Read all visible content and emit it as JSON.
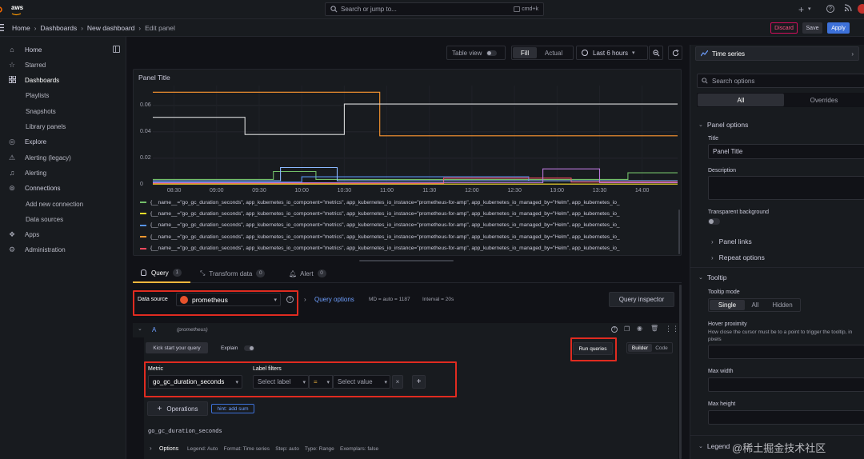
{
  "topbar": {
    "aws_label": "aws",
    "search_placeholder": "Search or jump to...",
    "search_shortcut": "cmd+k"
  },
  "breadcrumb": {
    "items": [
      "Home",
      "Dashboards",
      "New dashboard",
      "Edit panel"
    ],
    "discard_label": "Discard",
    "save_label": "Save",
    "apply_label": "Apply"
  },
  "sidebar": {
    "items": [
      {
        "label": "Home",
        "icon": "home-icon"
      },
      {
        "label": "Starred",
        "icon": "star-icon"
      },
      {
        "label": "Dashboards",
        "icon": "dashboards-icon"
      },
      {
        "label": "Playlists",
        "sub": true
      },
      {
        "label": "Snapshots",
        "sub": true
      },
      {
        "label": "Library panels",
        "sub": true
      },
      {
        "label": "Explore",
        "icon": "explore-icon"
      },
      {
        "label": "Alerting (legacy)",
        "icon": "alert-icon"
      },
      {
        "label": "Alerting",
        "icon": "bell-icon"
      },
      {
        "label": "Connections",
        "icon": "connections-icon"
      },
      {
        "label": "Add new connection",
        "sub": true
      },
      {
        "label": "Data sources",
        "sub": true
      },
      {
        "label": "Apps",
        "icon": "apps-icon"
      },
      {
        "label": "Administration",
        "icon": "gear-icon"
      }
    ]
  },
  "toolbar": {
    "table_view_label": "Table view",
    "fill_label": "Fill",
    "actual_label": "Actual",
    "time_range_label": "Last 6 hours"
  },
  "panel": {
    "title": "Panel Title",
    "legend": [
      "{__name__=\"go_gc_duration_seconds\", app_kubernetes_io_component=\"metrics\", app_kubernetes_io_instance=\"prometheus-for-amp\", app_kubernetes_io_managed_by=\"Helm\", app_kubernetes_io_",
      "{__name__=\"go_gc_duration_seconds\", app_kubernetes_io_component=\"metrics\", app_kubernetes_io_instance=\"prometheus-for-amp\", app_kubernetes_io_managed_by=\"Helm\", app_kubernetes_io_",
      "{__name__=\"go_gc_duration_seconds\", app_kubernetes_io_component=\"metrics\", app_kubernetes_io_instance=\"prometheus-for-amp\", app_kubernetes_io_managed_by=\"Helm\", app_kubernetes_io_",
      "{__name__=\"go_gc_duration_seconds\", app_kubernetes_io_component=\"metrics\", app_kubernetes_io_instance=\"prometheus-for-amp\", app_kubernetes_io_managed_by=\"Helm\", app_kubernetes_io_",
      "{__name__=\"go_gc_duration_seconds\", app_kubernetes_io_component=\"metrics\", app_kubernetes_io_instance=\"prometheus-for-amp\", app_kubernetes_io_managed_by=\"Helm\", app_kubernetes_io_"
    ]
  },
  "chart_data": {
    "type": "line",
    "x_ticks": [
      "08:30",
      "09:00",
      "09:30",
      "10:00",
      "10:30",
      "11:00",
      "11:30",
      "12:00",
      "12:30",
      "13:00",
      "13:30",
      "14:00"
    ],
    "y_ticks": [
      "0.06",
      "0.04",
      "0.02",
      "0"
    ],
    "ylim": [
      0,
      0.075
    ],
    "xlim": [
      "08:15",
      "14:25"
    ],
    "series": [
      {
        "color": "#ff9830",
        "points": [
          [
            "08:15",
            0.07
          ],
          [
            "10:55",
            0.07
          ],
          [
            "10:55",
            0.037
          ],
          [
            "14:25",
            0.037
          ]
        ]
      },
      {
        "color": "#d8d9da",
        "points": [
          [
            "08:15",
            0.051
          ],
          [
            "09:20",
            0.051
          ],
          [
            "09:20",
            0.038
          ],
          [
            "10:30",
            0.038
          ],
          [
            "10:30",
            0.061
          ],
          [
            "14:25",
            0.061
          ]
        ]
      },
      {
        "color": "#73bf69",
        "points": [
          [
            "08:15",
            0.004
          ],
          [
            "09:40",
            0.004
          ],
          [
            "09:40",
            0.01
          ],
          [
            "10:10",
            0.01
          ],
          [
            "10:10",
            0.004
          ],
          [
            "13:50",
            0.004
          ],
          [
            "13:50",
            0.009
          ],
          [
            "14:25",
            0.009
          ]
        ]
      },
      {
        "color": "#5794f2",
        "points": [
          [
            "08:15",
            0.002
          ],
          [
            "10:00",
            0.002
          ],
          [
            "10:00",
            0.006
          ],
          [
            "12:40",
            0.006
          ],
          [
            "12:40",
            0.003
          ],
          [
            "14:25",
            0.003
          ]
        ]
      },
      {
        "color": "#f2495c",
        "points": [
          [
            "08:15",
            0.001
          ],
          [
            "11:40",
            0.001
          ],
          [
            "11:40",
            0.005
          ],
          [
            "13:10",
            0.005
          ],
          [
            "13:10",
            0.002
          ],
          [
            "14:25",
            0.002
          ]
        ]
      },
      {
        "color": "#8ab8ff",
        "points": [
          [
            "08:15",
            0.003
          ],
          [
            "09:45",
            0.003
          ],
          [
            "09:45",
            0.013
          ],
          [
            "10:25",
            0.013
          ],
          [
            "10:25",
            0.003
          ],
          [
            "14:25",
            0.003
          ]
        ]
      },
      {
        "color": "#b877d9",
        "points": [
          [
            "08:15",
            0.0015
          ],
          [
            "12:50",
            0.0015
          ],
          [
            "12:50",
            0.012
          ],
          [
            "13:30",
            0.012
          ],
          [
            "13:30",
            0.0015
          ],
          [
            "14:25",
            0.0015
          ]
        ]
      },
      {
        "color": "#fade2a",
        "points": [
          [
            "08:15",
            0.0005
          ],
          [
            "14:25",
            0.0005
          ]
        ]
      }
    ]
  },
  "legend_colors": [
    "#73bf69",
    "#fade2a",
    "#5794f2",
    "#ff9830",
    "#f2495c"
  ],
  "query_tabs": [
    {
      "label": "Query",
      "count": "1"
    },
    {
      "label": "Transform data",
      "count": "0"
    },
    {
      "label": "Alert",
      "count": "0"
    }
  ],
  "query": {
    "datasource_label": "Data source",
    "datasource_value": "prometheus",
    "query_options_label": "Query options",
    "md_text": "MD = auto = 1187",
    "interval_text": "Interval = 20s",
    "inspector_label": "Query inspector",
    "ref_id": "A",
    "ref_source": "(prometheus)",
    "kickstart_label": "Kick start your query",
    "explain_label": "Explain",
    "run_queries_label": "Run queries",
    "builder_label": "Builder",
    "code_label": "Code",
    "metric_label": "Metric",
    "metric_value": "go_gc_duration_seconds",
    "label_filters_label": "Label filters",
    "select_label_placeholder": "Select label",
    "operator": "=",
    "select_value_placeholder": "Select value",
    "operations_label": "Operations",
    "hint_label": "hint: add sum",
    "preview_text": "go_gc_duration_seconds",
    "options_label": "Options",
    "options_summary": "Legend: Auto    Format: Time series    Step: auto    Type: Range    Exemplars: false"
  },
  "options": {
    "viz_label": "Time series",
    "search_placeholder": "Search options",
    "tab_all": "All",
    "tab_overrides": "Overrides",
    "panel_options_label": "Panel options",
    "title_label": "Title",
    "title_value": "Panel Title",
    "description_label": "Description",
    "transparent_label": "Transparent background",
    "panel_links_label": "Panel links",
    "repeat_options_label": "Repeat options",
    "tooltip_label": "Tooltip",
    "tooltip_mode_label": "Tooltip mode",
    "mode_single": "Single",
    "mode_all": "All",
    "mode_hidden": "Hidden",
    "hover_label": "Hover proximity",
    "hover_desc": "How close the cursor must be to a point to trigger the tooltip, in pixels",
    "max_width_label": "Max width",
    "max_height_label": "Max height",
    "legend_label": "Legend"
  },
  "watermark": "@稀土掘金技术社区"
}
